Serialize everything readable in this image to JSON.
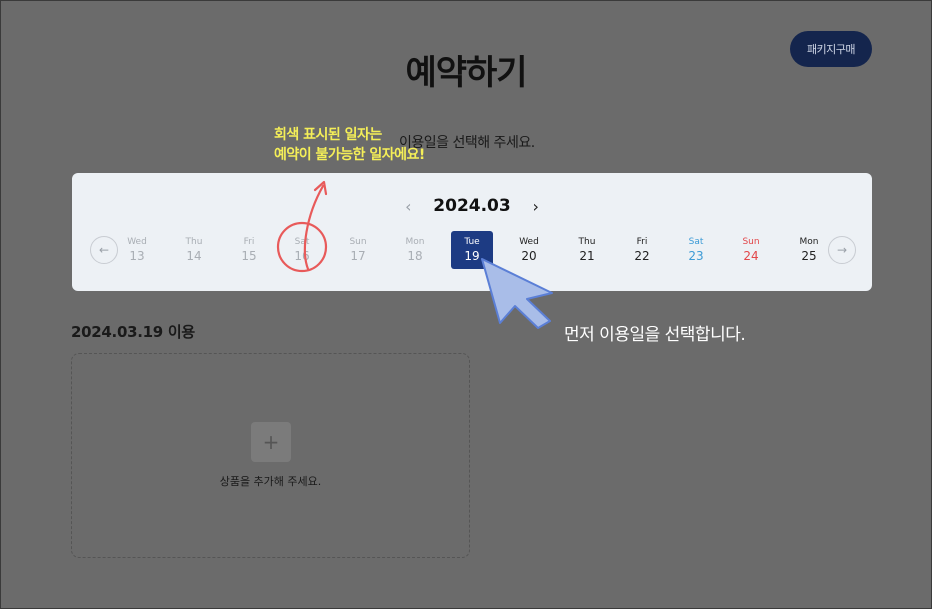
{
  "header": {
    "title": "예약하기",
    "package_button": "패키지구매"
  },
  "annotations": {
    "gray_note_line1": "회색 표시된 일자는",
    "gray_note_line2": "예약이 불가능한 일자에요!",
    "select_hint": "먼저 이용일을 선택합니다."
  },
  "calendar": {
    "prompt": "이용일을 선택해 주세요.",
    "month": "2024.03",
    "prev_month_icon": "chevron-left-icon",
    "next_month_icon": "chevron-right-icon",
    "days": [
      {
        "dow": "Wed",
        "date": "13",
        "state": "disabled"
      },
      {
        "dow": "Thu",
        "date": "14",
        "state": "disabled"
      },
      {
        "dow": "Fri",
        "date": "15",
        "state": "disabled"
      },
      {
        "dow": "Sat",
        "date": "16",
        "state": "disabled"
      },
      {
        "dow": "Sun",
        "date": "17",
        "state": "disabled"
      },
      {
        "dow": "Mon",
        "date": "18",
        "state": "disabled"
      },
      {
        "dow": "Tue",
        "date": "19",
        "state": "selected"
      },
      {
        "dow": "Wed",
        "date": "20",
        "state": "available"
      },
      {
        "dow": "Thu",
        "date": "21",
        "state": "available"
      },
      {
        "dow": "Fri",
        "date": "22",
        "state": "available"
      },
      {
        "dow": "Sat",
        "date": "23",
        "state": "saturday"
      },
      {
        "dow": "Sun",
        "date": "24",
        "state": "sunday"
      },
      {
        "dow": "Mon",
        "date": "25",
        "state": "available"
      }
    ]
  },
  "usage": {
    "date_label": "2024.03.19 이용",
    "add_product_text": "상품을 추가해 주세요.",
    "add_icon": "plus-icon"
  },
  "colors": {
    "overlay": "#6b6b6b",
    "selected_day": "#1d3b83",
    "saturday": "#3d9bd6",
    "sunday": "#e2474a",
    "note_yellow": "#f4ee58",
    "annotation_red": "#e85a5a"
  }
}
